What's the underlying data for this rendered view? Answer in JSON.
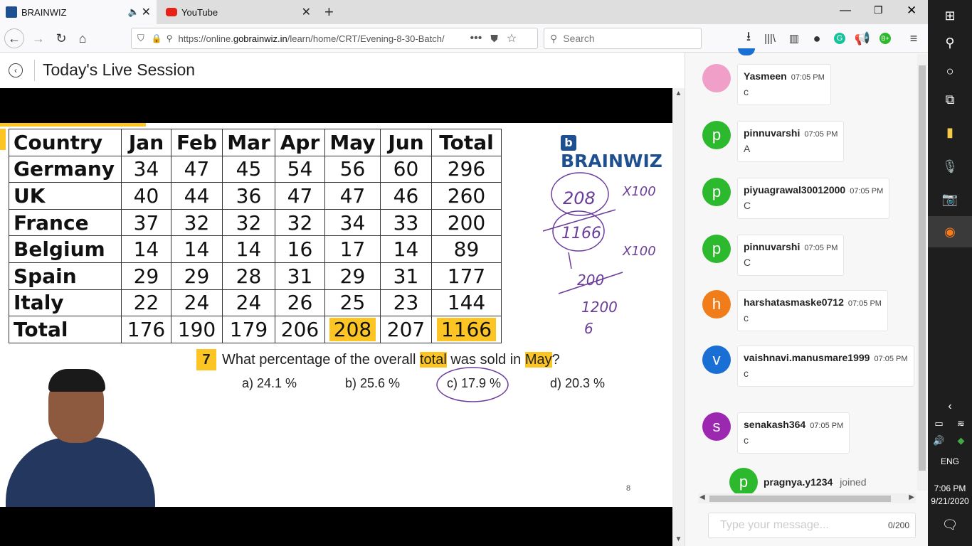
{
  "tabs": [
    {
      "title": "BRAINWIZ"
    },
    {
      "title": "YouTube"
    }
  ],
  "url": {
    "prefix": "https://online.",
    "domain": "gobrainwiz.in",
    "path": "/learn/home/CRT/Evening-8-30-Batch/"
  },
  "search": {
    "placeholder": "Search"
  },
  "page": {
    "title": "Today's Live Session"
  },
  "slide": {
    "brand": "BRAINWIZ",
    "table": {
      "headers": [
        "Country",
        "Jan",
        "Feb",
        "Mar",
        "Apr",
        "May",
        "Jun",
        "Total"
      ],
      "rows": [
        [
          "Germany",
          "34",
          "47",
          "45",
          "54",
          "56",
          "60",
          "296"
        ],
        [
          "UK",
          "40",
          "44",
          "36",
          "47",
          "47",
          "46",
          "260"
        ],
        [
          "France",
          "37",
          "32",
          "32",
          "32",
          "34",
          "33",
          "200"
        ],
        [
          "Belgium",
          "14",
          "14",
          "14",
          "16",
          "17",
          "14",
          "89"
        ],
        [
          "Spain",
          "29",
          "29",
          "28",
          "31",
          "29",
          "31",
          "177"
        ],
        [
          "Italy",
          "22",
          "24",
          "24",
          "26",
          "25",
          "23",
          "144"
        ],
        [
          "Total",
          "176",
          "190",
          "179",
          "206",
          "208",
          "207",
          "1166"
        ]
      ]
    },
    "question": {
      "number": "7",
      "before": "What percentage of the overall",
      "hl1": "total",
      "middle": "was sold in",
      "hl2": "May",
      "after": "?"
    },
    "options": [
      "a) 24.1 %",
      "b) 25.6 %",
      "c) 17.9 %",
      "d) 20.3 %"
    ],
    "annotations": [
      "208",
      "1166",
      "X100",
      "200",
      "X100",
      "1200",
      "6"
    ],
    "page_number": "8"
  },
  "chat": {
    "messages": [
      {
        "initial": "",
        "name": "Yasmeen",
        "time": "07:05 PM",
        "text": "c",
        "color": "#f0a0c8"
      },
      {
        "initial": "p",
        "name": "pinnuvarshi",
        "time": "07:05 PM",
        "text": "A",
        "color": "#2db92d"
      },
      {
        "initial": "p",
        "name": "piyuagrawal30012000",
        "time": "07:05 PM",
        "text": "C",
        "color": "#2db92d"
      },
      {
        "initial": "p",
        "name": "pinnuvarshi",
        "time": "07:05 PM",
        "text": "C",
        "color": "#2db92d"
      },
      {
        "initial": "h",
        "name": "harshatasmaske0712",
        "time": "07:05 PM",
        "text": "c",
        "color": "#f07d1a"
      },
      {
        "initial": "v",
        "name": "vaishnavi.manusmare1999",
        "time": "07:05 PM",
        "text": "c",
        "color": "#1a6fd4"
      },
      {
        "initial": "s",
        "name": "senakash364",
        "time": "07:05 PM",
        "text": "c",
        "color": "#9c27b0"
      }
    ],
    "joined": {
      "initial": "p",
      "name": "pragnya.y1234",
      "status": "joined",
      "color": "#2db92d"
    },
    "input_placeholder": "Type your message...",
    "char_count": "0/200"
  },
  "taskbar": {
    "language": "ENG",
    "time": "7:06 PM",
    "date": "9/21/2020"
  }
}
